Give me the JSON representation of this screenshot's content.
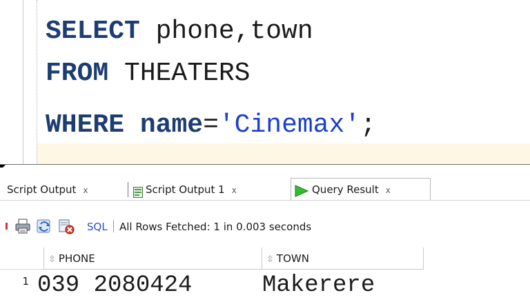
{
  "editor": {
    "line1": {
      "keyword": "SELECT",
      "rest": " phone,town"
    },
    "line2": {
      "keyword": "FROM",
      "rest": " THEATERS"
    },
    "line3": {
      "keyword1": "WHERE",
      "space": " ",
      "keyword2": "name",
      "op": "=",
      "string": "'Cinemax'",
      "end": ";"
    }
  },
  "tabs": [
    {
      "label": "Script Output",
      "close": "x",
      "icon": ""
    },
    {
      "label": "Script Output 1",
      "close": "x",
      "icon": "script-output-icon"
    },
    {
      "label": "Query Result",
      "close": "x",
      "icon": "run-green-icon",
      "active": true
    }
  ],
  "toolbar": {
    "sql_label": "SQL",
    "separator": "|",
    "status": "All Rows Fetched: 1 in 0.003 seconds",
    "icons": [
      "print-icon",
      "refresh-icon",
      "cancel-icon"
    ]
  },
  "grid": {
    "columns": [
      "PHONE",
      "TOWN"
    ],
    "rows": [
      {
        "num": "1",
        "phone": "039 2080424",
        "town": "Makerere"
      }
    ]
  },
  "colors": {
    "keyword": "#1d3d72",
    "string": "#1a3fd0",
    "sql_link": "#2b4fc7",
    "current_line": "#fdf7e4"
  }
}
